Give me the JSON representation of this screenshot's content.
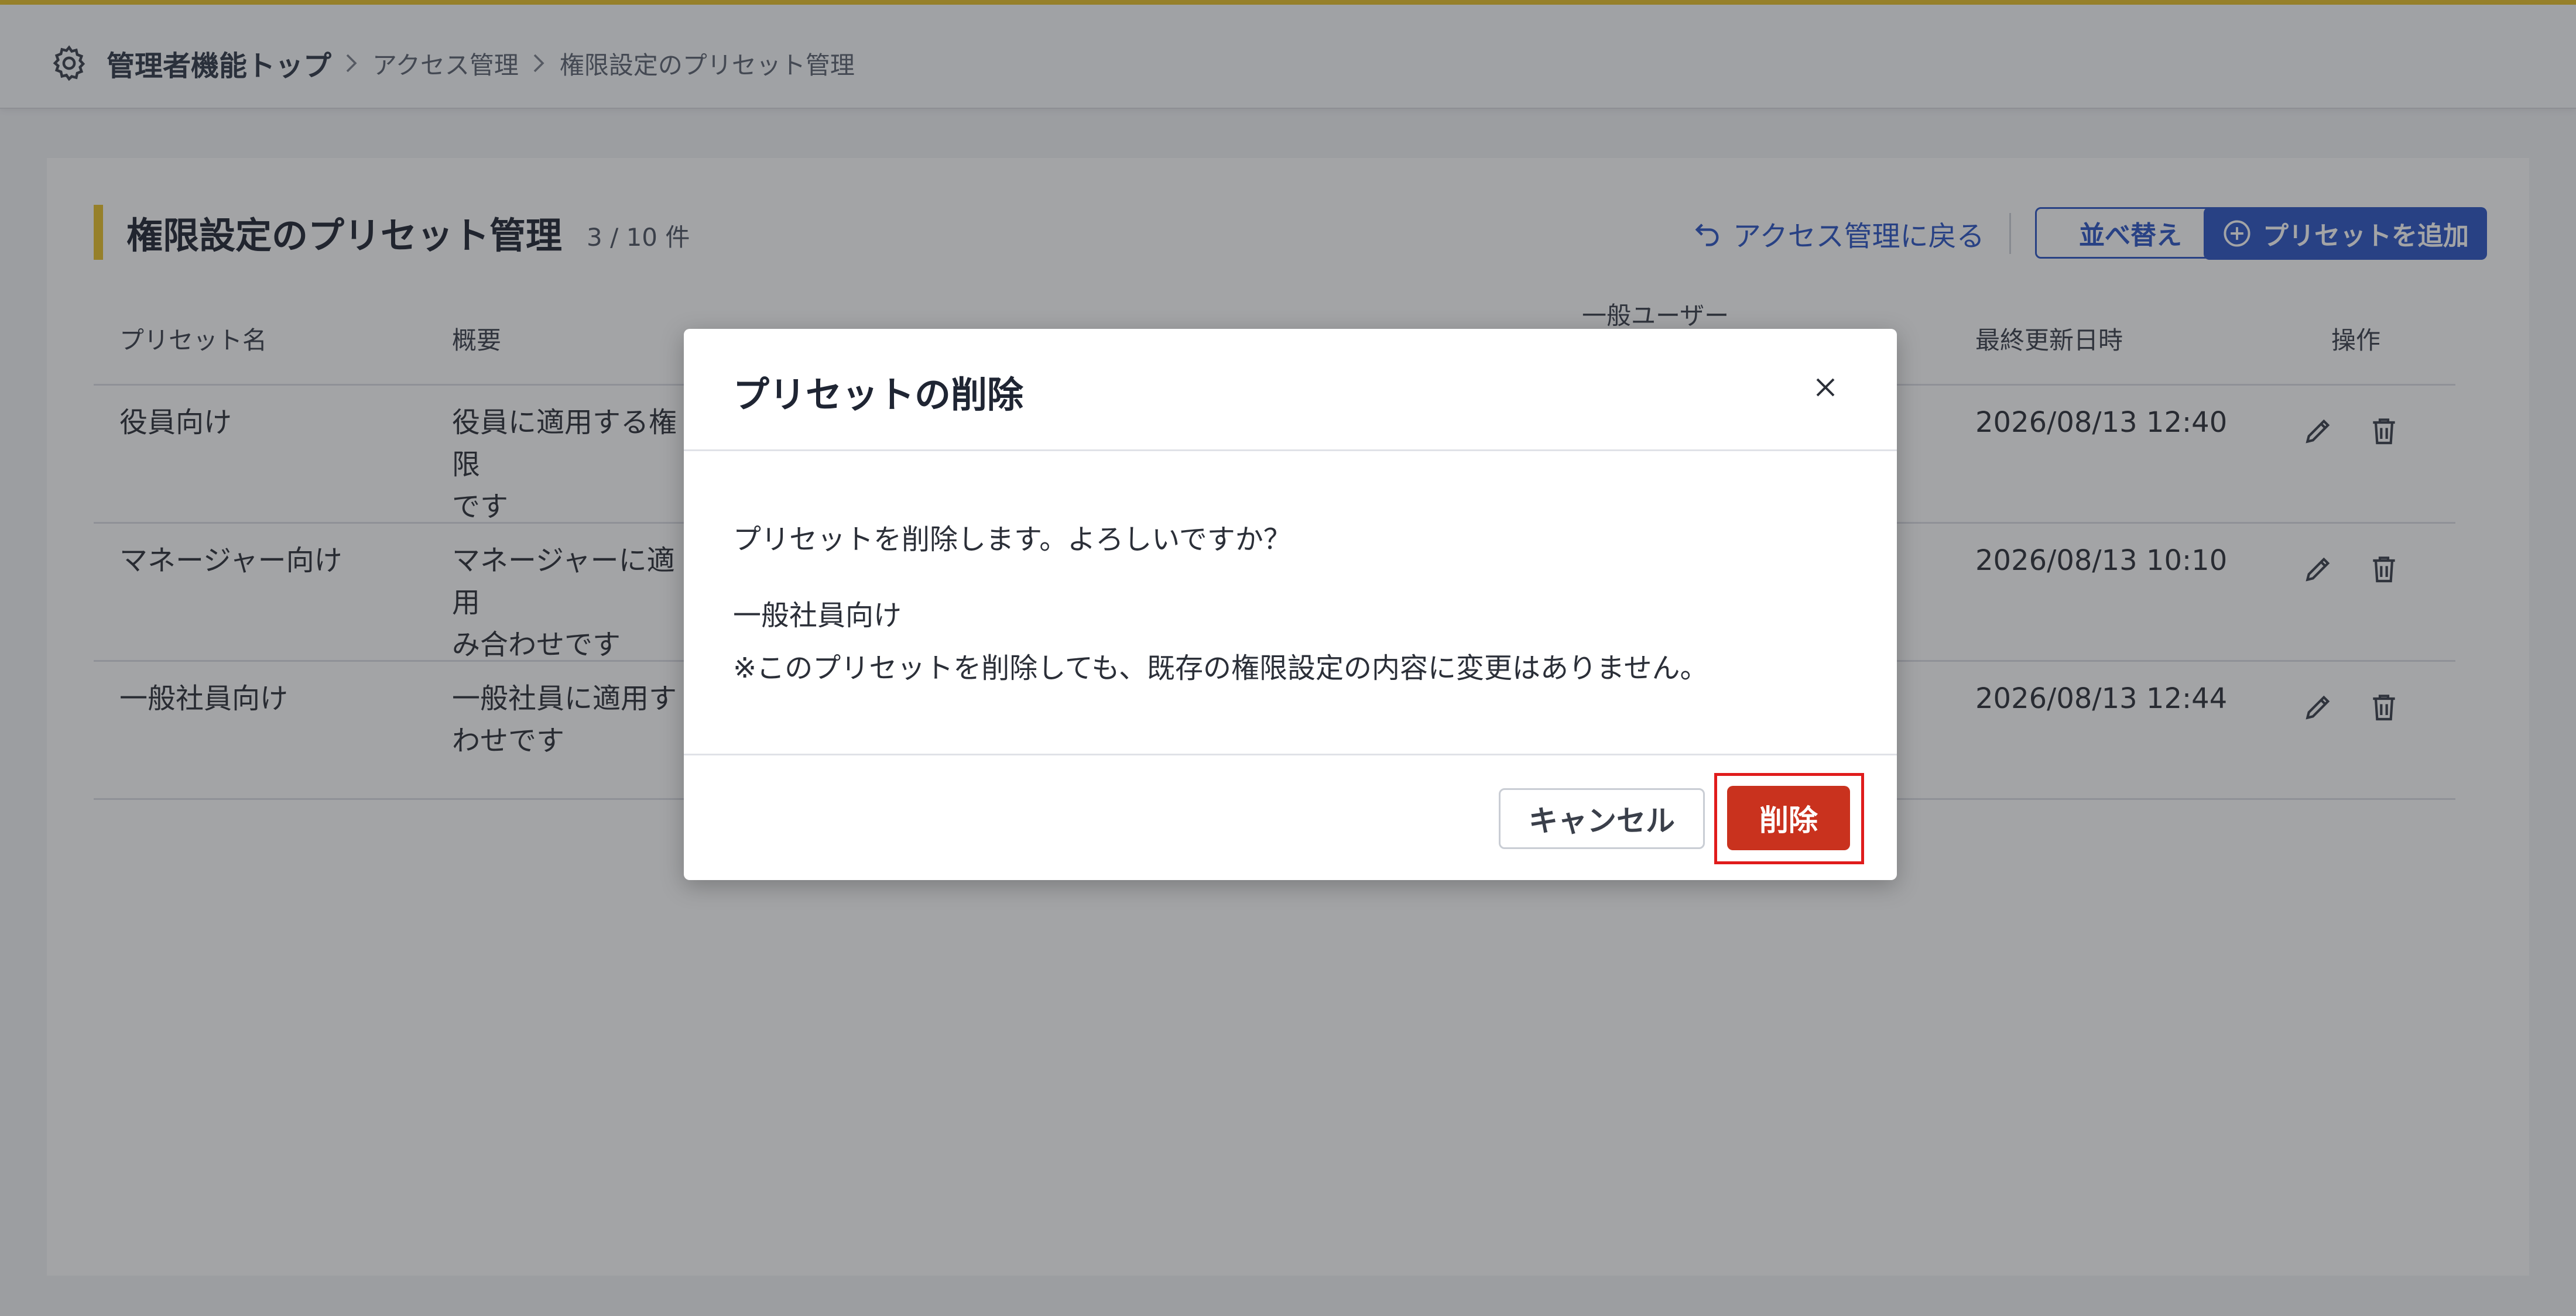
{
  "header": {
    "breadcrumb_root": "管理者機能トップ",
    "breadcrumb_items": [
      "アクセス管理",
      "権限設定のプリセット管理"
    ]
  },
  "page": {
    "title": "権限設定のプリセット管理",
    "count": "3 / 10 件",
    "back_link": "アクセス管理に戻る",
    "sort_button": "並べ替え",
    "add_button": "プリセットを追加"
  },
  "table": {
    "columns": [
      "プリセット名",
      "概要",
      "一般ユーザー",
      "最終更新日時",
      "操作"
    ],
    "rows": [
      {
        "name": "役員向け",
        "summary_line1": "役員に適用する権限",
        "summary_line2": "です",
        "updated": "2026/08/13 12:40"
      },
      {
        "name": "マネージャー向け",
        "summary_line1": "マネージャーに適用",
        "summary_line2": "み合わせです",
        "updated": "2026/08/13 10:10"
      },
      {
        "name": "一般社員向け",
        "summary_line1": "一般社員に適用す",
        "summary_line2": "わせです",
        "updated": "2026/08/13 12:44"
      }
    ]
  },
  "modal": {
    "title": "プリセットの削除",
    "question": "プリセットを削除します。よろしいですか？",
    "preset_name": "一般社員向け",
    "note": "※このプリセットを削除しても、既存の権限設定の内容に変更はありません。",
    "cancel_button": "キャンセル",
    "delete_button": "削除"
  },
  "colors": {
    "accent_yellow": "#e9c22a",
    "primary_blue": "#2c55c4",
    "danger_red": "#c9321e",
    "highlight_red": "#e01c1c"
  },
  "icons": [
    "gear-icon",
    "chevron-right-icon",
    "undo-arrow-icon",
    "plus-circle-icon",
    "pencil-icon",
    "trash-icon",
    "close-icon"
  ]
}
